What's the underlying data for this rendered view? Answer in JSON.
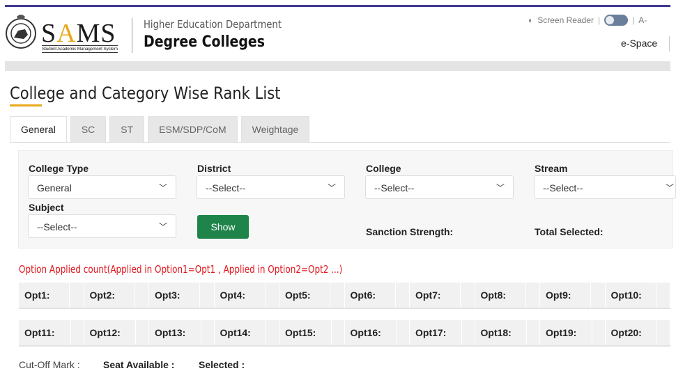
{
  "header": {
    "logo_text": "SAMS",
    "logo_subtitle": "Student Academic Management System",
    "department": "Higher Education Department",
    "portal": "Degree Colleges",
    "screen_reader": "Screen Reader",
    "font_size_toggle": "A-",
    "espace": "e-Space",
    "brand_accent": "#e8a81a",
    "top_bar_color": "#3f3a8f"
  },
  "page": {
    "title": "College and Category Wise Rank List"
  },
  "tabs": [
    {
      "label": "General",
      "active": true
    },
    {
      "label": "SC"
    },
    {
      "label": "ST"
    },
    {
      "label": "ESM/SDP/CoM"
    },
    {
      "label": "Weightage"
    }
  ],
  "filters": {
    "college_type": {
      "label": "College Type",
      "value": "General"
    },
    "district": {
      "label": "District",
      "value": "--Select--"
    },
    "college": {
      "label": "College",
      "value": "--Select--"
    },
    "stream": {
      "label": "Stream",
      "value": "--Select--"
    },
    "subject": {
      "label": "Subject",
      "value": "--Select--"
    },
    "show_label": "Show",
    "sanction_strength": "Sanction Strength:",
    "total_selected": "Total Selected:"
  },
  "note": "Option Applied count(Applied in Option1=Opt1 , Applied in Option2=Opt2 ...)",
  "options_row1": [
    "Opt1:",
    "Opt2:",
    "Opt3:",
    "Opt4:",
    "Opt5:",
    "Opt6:",
    "Opt7:",
    "Opt8:",
    "Opt9:",
    "Opt10:"
  ],
  "options_row2": [
    "Opt11:",
    "Opt12:",
    "Opt13:",
    "Opt14:",
    "Opt15:",
    "Opt16:",
    "Opt17:",
    "Opt18:",
    "Opt19:",
    "Opt20:"
  ],
  "footer": {
    "cutoff": "Cut-Off Mark :",
    "seat_available": "Seat Available :",
    "selected": "Selected :"
  }
}
